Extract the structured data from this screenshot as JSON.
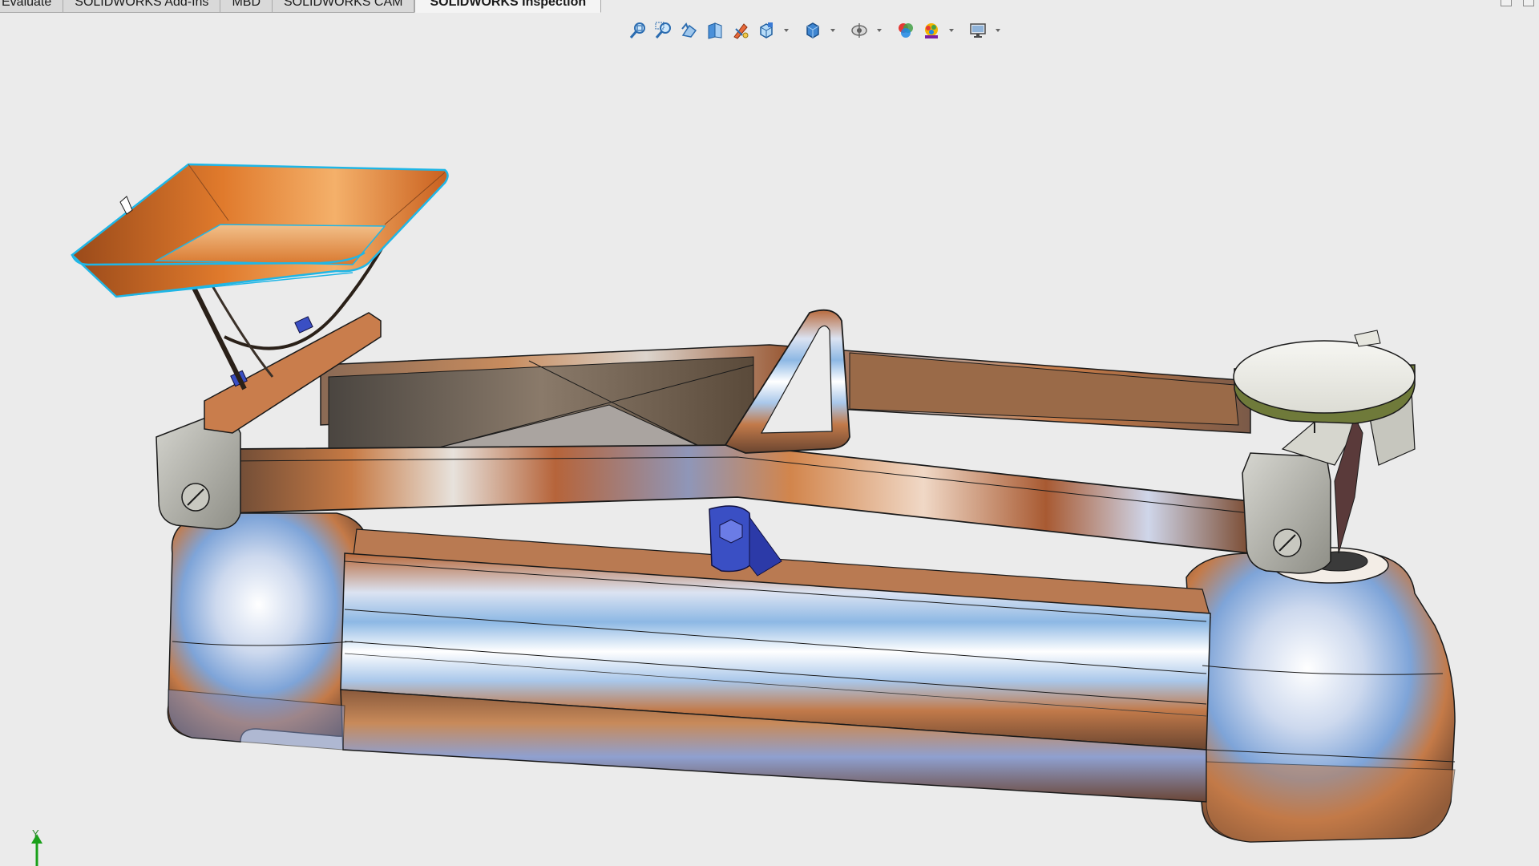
{
  "command_manager": {
    "tabs": [
      {
        "label": "Evaluate",
        "active": false
      },
      {
        "label": "SOLIDWORKS Add-Ins",
        "active": false
      },
      {
        "label": "MBD",
        "active": false
      },
      {
        "label": "SOLIDWORKS CAM",
        "active": false
      },
      {
        "label": "SOLIDWORKS Inspection",
        "active": true
      }
    ]
  },
  "view_toolbar": {
    "tools": [
      {
        "icon": "zoom-to-fit-icon"
      },
      {
        "icon": "zoom-to-area-icon"
      },
      {
        "icon": "previous-view-icon"
      },
      {
        "icon": "section-view-icon"
      },
      {
        "icon": "dynamic-annotation-views-icon"
      },
      {
        "icon": "view-orientation-icon"
      },
      {
        "icon": "display-style-icon"
      },
      {
        "icon": "hide-show-items-icon"
      },
      {
        "icon": "edit-appearance-icon"
      },
      {
        "icon": "apply-scene-icon"
      },
      {
        "icon": "view-settings-icon"
      }
    ]
  },
  "triad": {
    "axis_label": "Y"
  },
  "colors": {
    "viewport_background": "#ebebeb",
    "selection_highlight": "#1fb6e6",
    "hardware_blue": "#3a4fc4",
    "active_tab": "#f4f4f4",
    "inactive_tab": "#d9d9d9"
  }
}
